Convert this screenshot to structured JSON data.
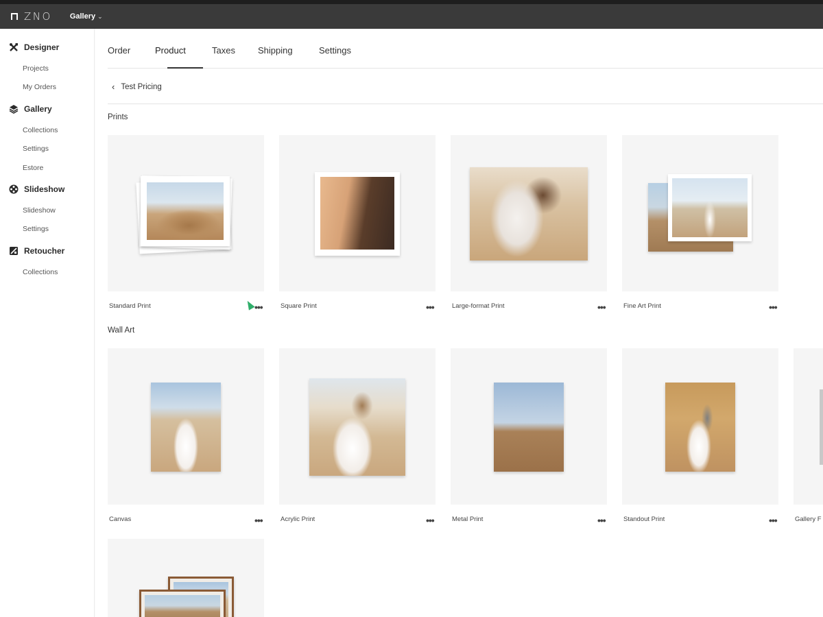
{
  "topbar": {
    "logo_text": "ZNO",
    "app_switcher_label": "Gallery",
    "app_switcher_chevron": "⌄"
  },
  "sidebar": {
    "sections": [
      {
        "label": "Designer",
        "icon": "tools-icon",
        "items": [
          "Projects",
          "My Orders"
        ]
      },
      {
        "label": "Gallery",
        "icon": "layers-icon",
        "items": [
          "Collections",
          "Settings",
          "Estore"
        ]
      },
      {
        "label": "Slideshow",
        "icon": "film-reel-icon",
        "items": [
          "Slideshow",
          "Settings"
        ]
      },
      {
        "label": "Retoucher",
        "icon": "retouch-icon",
        "items": [
          "Collections"
        ]
      }
    ]
  },
  "tabs": {
    "items": [
      "Order",
      "Product",
      "Taxes",
      "Shipping",
      "Settings"
    ],
    "active": "Product"
  },
  "breadcrumb": {
    "back_glyph": "‹",
    "label": "Test Pricing"
  },
  "sections": {
    "prints": {
      "title": "Prints",
      "products": [
        "Standard Print",
        "Square Print",
        "Large-format Print",
        "Fine Art Print"
      ]
    },
    "wall_art": {
      "title": "Wall Art",
      "products": [
        "Canvas",
        "Acrylic Print",
        "Metal Print",
        "Standout Print",
        "Gallery F"
      ]
    }
  },
  "more_glyph": "•••",
  "colors": {
    "topbar_bg": "#3a3a3a",
    "card_bg": "#f5f5f5",
    "cursor": "#2fae6a"
  }
}
